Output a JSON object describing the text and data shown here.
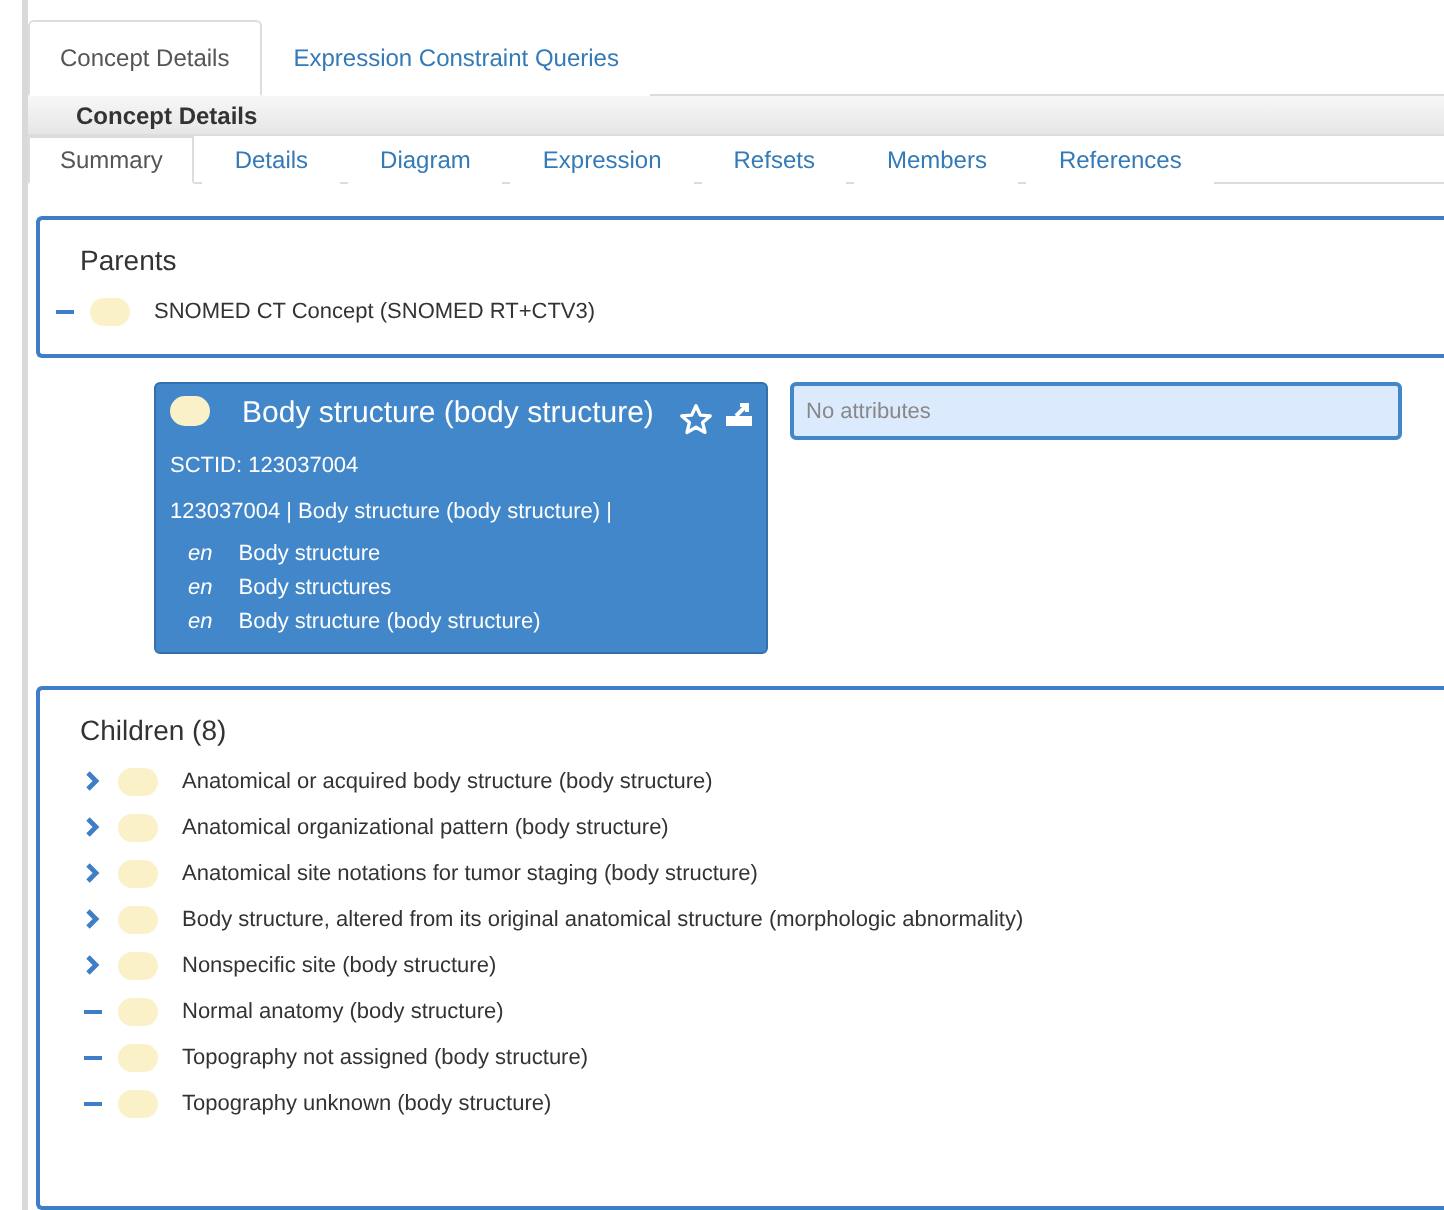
{
  "tabs": [
    {
      "label": "Concept Details",
      "selected": true
    },
    {
      "label": "Expression Constraint Queries",
      "selected": false
    }
  ],
  "panel": {
    "title": "Concept Details"
  },
  "subtabs": [
    {
      "label": "Summary",
      "selected": true
    },
    {
      "label": "Details",
      "selected": false
    },
    {
      "label": "Diagram",
      "selected": false
    },
    {
      "label": "Expression",
      "selected": false
    },
    {
      "label": "Refsets",
      "selected": false
    },
    {
      "label": "Members",
      "selected": false
    },
    {
      "label": "References",
      "selected": false
    }
  ],
  "parents": {
    "title": "Parents",
    "items": [
      {
        "label": "SNOMED CT Concept (SNOMED RT+CTV3)",
        "has_children": false
      }
    ]
  },
  "concept": {
    "title": "Body structure (body structure)",
    "sctid": "SCTID: 123037004",
    "expression": "123037004 | Body structure (body structure) |",
    "descriptions": [
      {
        "lang": "en",
        "term": "Body structure"
      },
      {
        "lang": "en",
        "term": "Body structures"
      },
      {
        "lang": "en",
        "term": "Body structure (body structure)"
      }
    ]
  },
  "attributes": {
    "placeholder": "No attributes"
  },
  "children": {
    "title": "Children (8)",
    "items": [
      {
        "label": "Anatomical or acquired body structure (body structure)",
        "has_children": true
      },
      {
        "label": "Anatomical organizational pattern (body structure)",
        "has_children": true
      },
      {
        "label": "Anatomical site notations for tumor staging (body structure)",
        "has_children": true
      },
      {
        "label": "Body structure, altered from its original anatomical structure (morphologic abnormality)",
        "has_children": true
      },
      {
        "label": "Nonspecific site (body structure)",
        "has_children": true
      },
      {
        "label": "Normal anatomy (body structure)",
        "has_children": false
      },
      {
        "label": "Topography not assigned (body structure)",
        "has_children": false
      },
      {
        "label": "Topography unknown (body structure)",
        "has_children": false
      }
    ]
  }
}
